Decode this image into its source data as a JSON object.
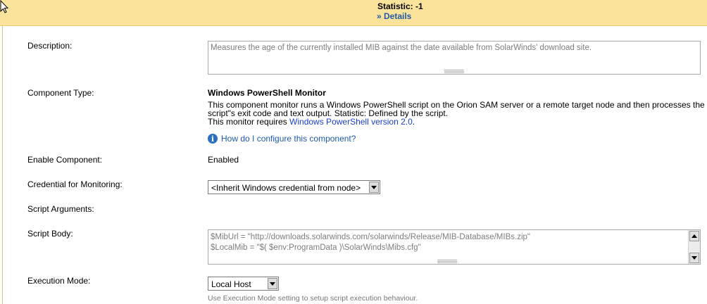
{
  "banner": {
    "statistic": "Statistic: -1",
    "details_link": "» Details"
  },
  "form": {
    "description": {
      "label": "Description:",
      "value": "Measures the age of the currently installed MIB against the date available from SolarWinds' download site."
    },
    "component_type": {
      "label": "Component Type:",
      "title": "Windows PowerShell Monitor",
      "description": "This component monitor runs a Windows PowerShell script on the Orion SAM server or a remote target node and then processes the script\"s exit code and text output. Statistic: Defined by the script.",
      "requires_prefix": "This monitor requires ",
      "requires_link": "Windows PowerShell version 2.0",
      "requires_suffix": ".",
      "help_link": "How do I configure this component?"
    },
    "enable_component": {
      "label": "Enable Component:",
      "value": "Enabled"
    },
    "credential": {
      "label": "Credential for Monitoring:",
      "selected": "<Inherit Windows credential from node>"
    },
    "script_arguments": {
      "label": "Script Arguments:"
    },
    "script_body": {
      "label": "Script Body:",
      "line1": "$MibUrl = \"http://downloads.solarwinds.com/solarwinds/Release/MIB-Database/MIBs.zip\"",
      "line2": "$LocalMib = \"$( $env:ProgramData )\\SolarWinds\\Mibs.cfg\""
    },
    "execution_mode": {
      "label": "Execution Mode:",
      "selected": "Local Host",
      "hint": "Use Execution Mode setting to setup script execution behaviour."
    }
  }
}
